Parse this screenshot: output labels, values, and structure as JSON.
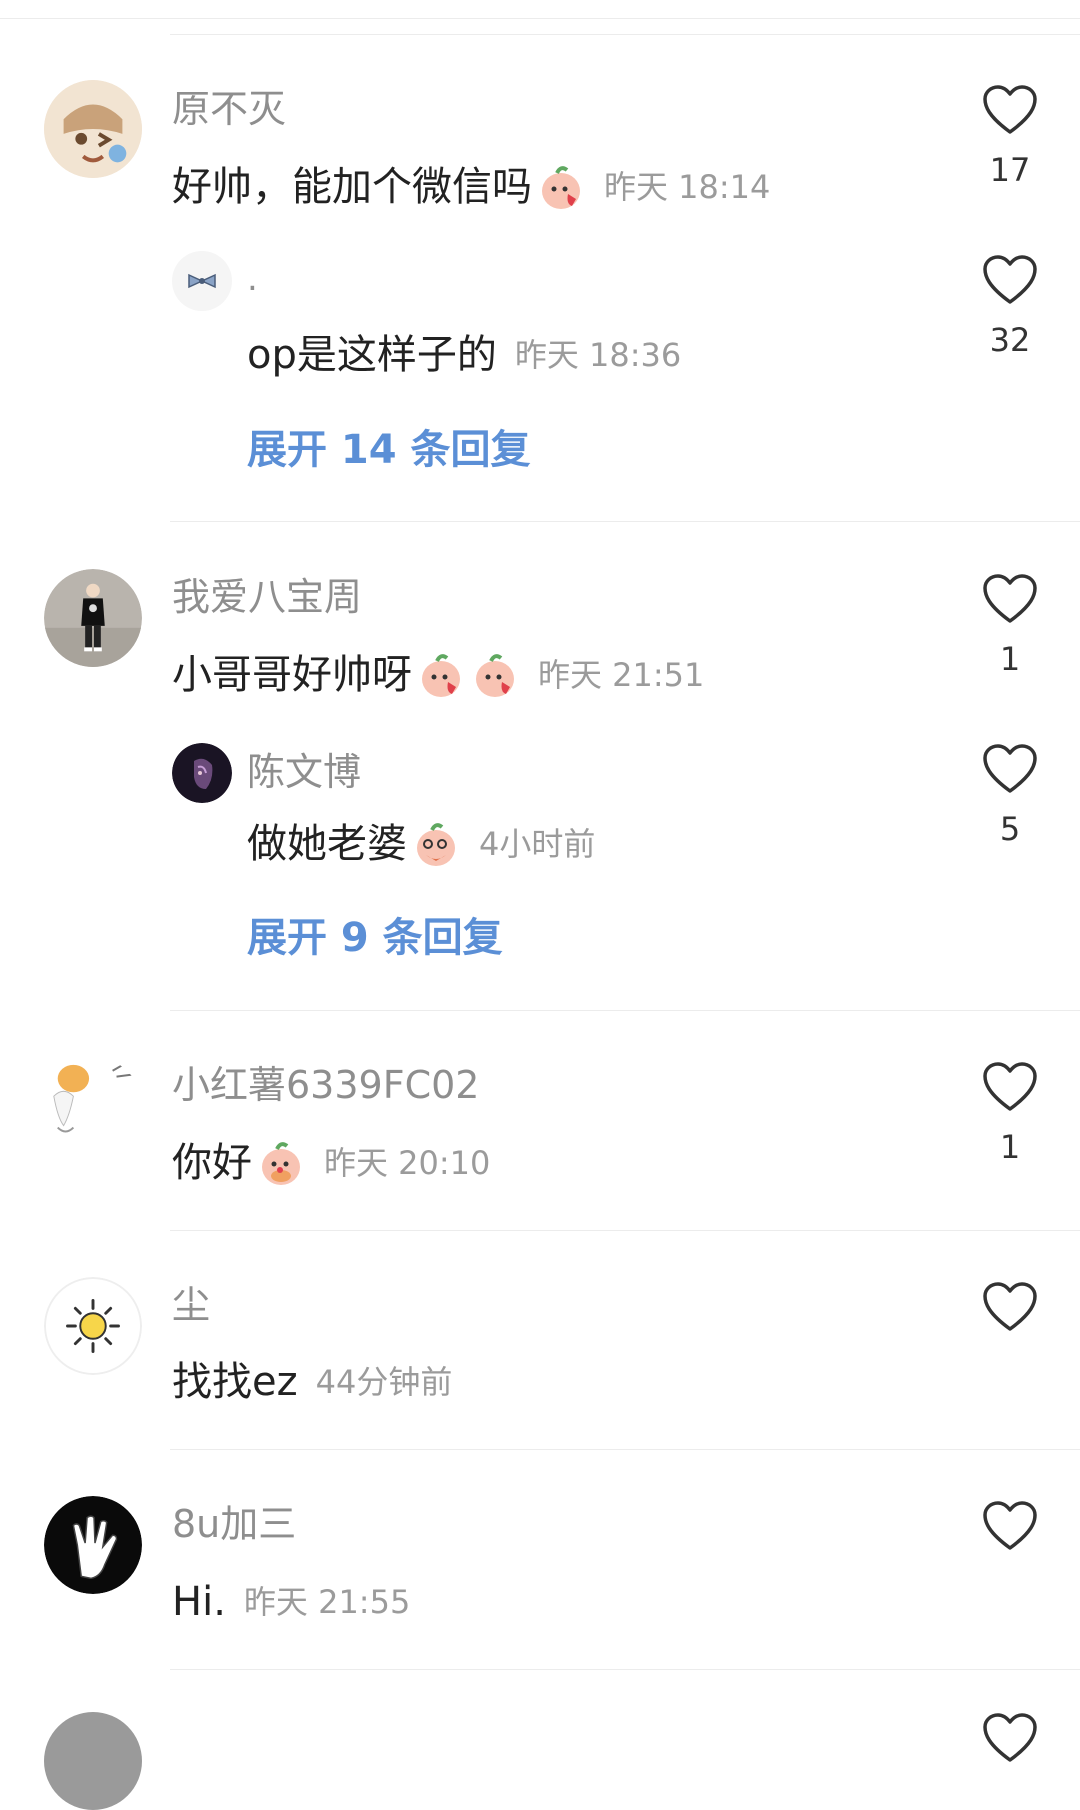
{
  "accent_color": "#5b8fd6",
  "comments": [
    {
      "user": "原不灭",
      "text": "好帅，能加个微信吗",
      "emojis": [
        "peach-kiss"
      ],
      "time": "昨天 18:14",
      "likes": "17",
      "reply": {
        "user": ".",
        "text": "op是这样子的",
        "time": "昨天 18:36",
        "likes": "32"
      },
      "expand": "展开 14 条回复"
    },
    {
      "user": "我爱八宝周",
      "text": "小哥哥好帅呀",
      "emojis": [
        "peach-kiss",
        "peach-kiss"
      ],
      "time": "昨天 21:51",
      "likes": "1",
      "reply": {
        "user": "陈文博",
        "text": "做她老婆",
        "emojis": [
          "peach-giggle"
        ],
        "time": "4小时前",
        "likes": "5"
      },
      "expand": "展开 9 条回复"
    },
    {
      "user": "小红薯6339FC02",
      "text": "你好",
      "emojis": [
        "peach-shy"
      ],
      "time": "昨天 20:10",
      "likes": "1"
    },
    {
      "user": "尘",
      "text": "找找ez",
      "time": "44分钟前",
      "likes": ""
    },
    {
      "user": "8u加三",
      "text": "Hi.",
      "time": "昨天 21:55",
      "likes": ""
    }
  ]
}
